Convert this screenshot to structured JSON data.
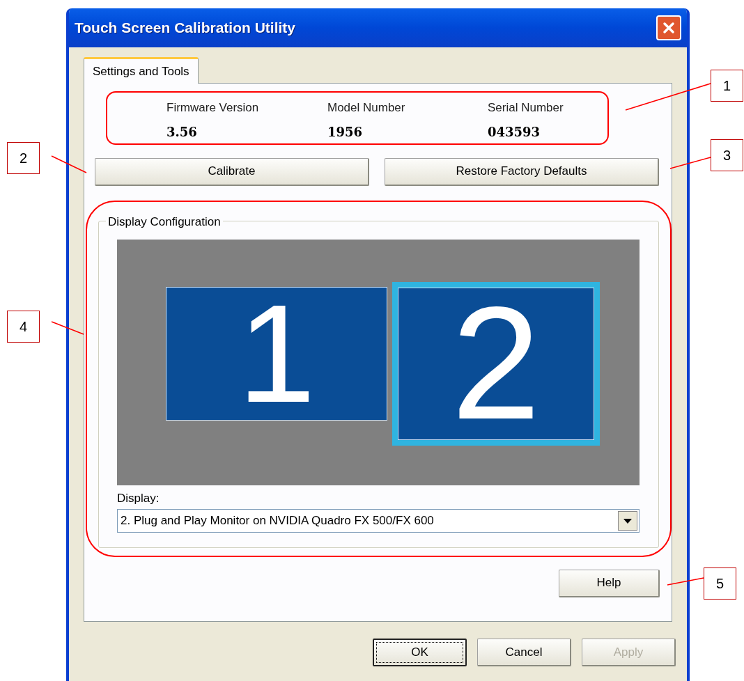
{
  "window": {
    "title": "Touch Screen Calibration Utility"
  },
  "tabs": [
    {
      "label": "Settings and Tools",
      "selected": true
    }
  ],
  "device_info": [
    {
      "label": "Firmware Version",
      "value": "3.56"
    },
    {
      "label": "Model Number",
      "value": "1956"
    },
    {
      "label": "Serial Number",
      "value": "043593"
    }
  ],
  "actions": [
    "Calibrate",
    "Restore Factory Defaults"
  ],
  "display_configuration": {
    "title": "Display Configuration",
    "monitors": [
      {
        "label": "1",
        "selected": false
      },
      {
        "label": "2",
        "selected": true
      }
    ],
    "display_label": "Display:",
    "display_value": "2. Plug and Play Monitor on NVIDIA Quadro FX 500/FX 600"
  },
  "help_button": "Help",
  "footer_buttons": [
    {
      "label": "OK",
      "default": true,
      "disabled": false
    },
    {
      "label": "Cancel",
      "default": false,
      "disabled": false
    },
    {
      "label": "Apply",
      "default": false,
      "disabled": true
    }
  ],
  "callouts": [
    "1",
    "2",
    "3",
    "4",
    "5"
  ]
}
